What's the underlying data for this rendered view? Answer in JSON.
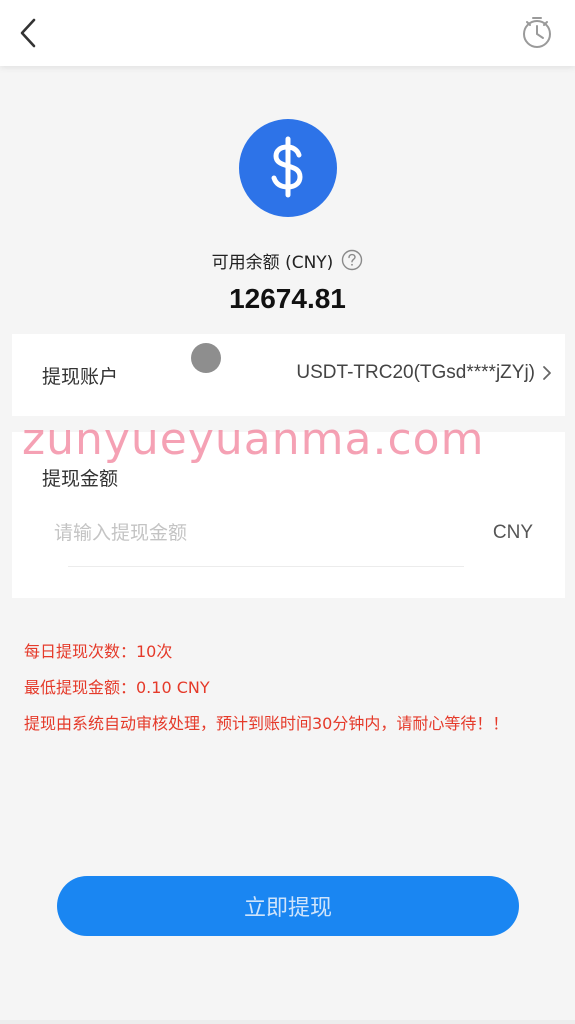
{
  "balance": {
    "label": "可用余额 (CNY)",
    "amount": "12674.81"
  },
  "account": {
    "label": "提现账户",
    "value": "USDT-TRC20(TGsd****jZYj)"
  },
  "amount": {
    "label": "提现金额",
    "placeholder": "请输入提现金额",
    "value": "",
    "unit": "CNY"
  },
  "watermark": "zunyueyuanma.com",
  "notes": {
    "daily_limit": "每日提现次数：10次",
    "min_amount": "最低提现金额：0.10 CNY",
    "review": "提现由系统自动审核处理，预计到账时间30分钟内，请耐心等待！！"
  },
  "submit": {
    "label": "立即提现"
  },
  "icons": {
    "back": "chevron-left-icon",
    "history": "clock-history-icon",
    "coin": "dollar-icon",
    "help": "question-circle-icon",
    "chevron": "chevron-right-icon"
  },
  "colors": {
    "primary": "#1a86f2",
    "coin": "#2d73e8",
    "warning": "#e53a2a",
    "watermark": "#f06e8c"
  }
}
